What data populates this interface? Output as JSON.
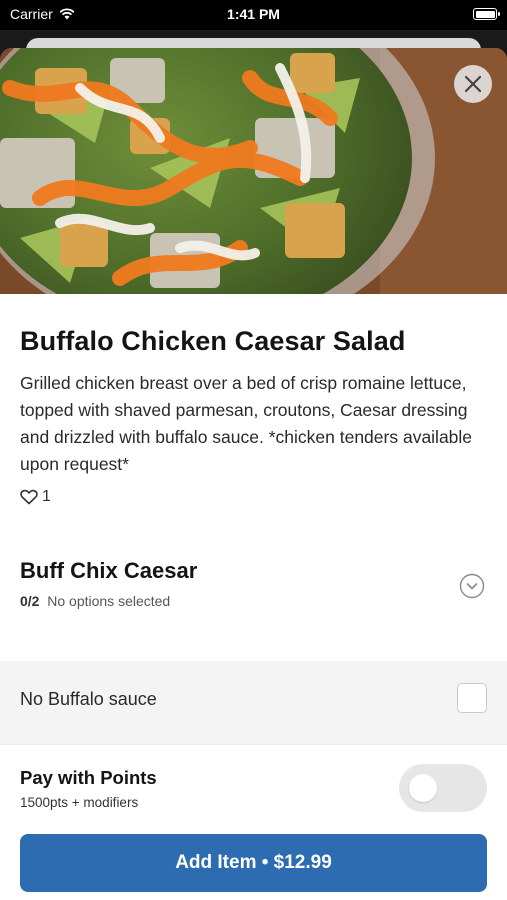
{
  "status_bar": {
    "carrier": "Carrier",
    "time": "1:41 PM"
  },
  "item": {
    "image_icon": "salad-photo",
    "title": "Buffalo Chicken Caesar Salad",
    "description": "Grilled chicken breast over a bed of crisp romaine lettuce, topped with shaved parmesan, croutons, Caesar dressing and drizzled with buffalo sauce. *chicken tenders available upon request*",
    "likes": "1"
  },
  "modifier_group": {
    "title": "Buff Chix Caesar",
    "count": "0/2",
    "status": "No options selected",
    "options": [
      {
        "label": "No Buffalo sauce",
        "checked": false
      }
    ]
  },
  "points": {
    "title": "Pay with Points",
    "subtitle": "1500pts + modifiers",
    "enabled": false
  },
  "add_button": {
    "label": "Add Item • $12.99"
  },
  "colors": {
    "primary": "#2d6cb1",
    "toggle_off": "#e6e6e6",
    "option_bg": "#f4f4f4"
  }
}
